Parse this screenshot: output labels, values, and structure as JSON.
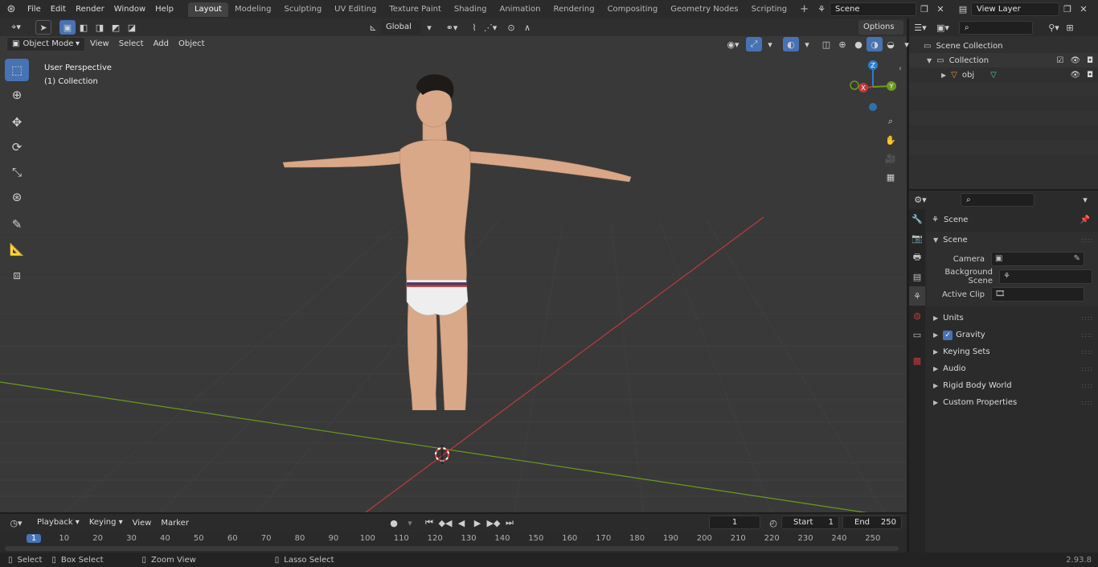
{
  "menu": [
    "File",
    "Edit",
    "Render",
    "Window",
    "Help"
  ],
  "workspaces": [
    "Layout",
    "Modeling",
    "Sculpting",
    "UV Editing",
    "Texture Paint",
    "Shading",
    "Animation",
    "Rendering",
    "Compositing",
    "Geometry Nodes",
    "Scripting"
  ],
  "active_workspace": "Layout",
  "scene_name": "Scene",
  "view_layer": "View Layer",
  "viewport": {
    "mode": "Object Mode",
    "menus": [
      "View",
      "Select",
      "Add",
      "Object"
    ],
    "transform_orientation": "Global",
    "options_label": "Options",
    "overlay_line1": "User Perspective",
    "overlay_line2": "(1) Collection",
    "gizmo_axes": [
      "X",
      "Y",
      "Z"
    ]
  },
  "outliner": {
    "root": "Scene Collection",
    "collection": "Collection",
    "object": "obj"
  },
  "properties": {
    "header": "Scene",
    "panel": "Scene",
    "fields": [
      {
        "label": "Camera",
        "value": ""
      },
      {
        "label": "Background Scene",
        "value": ""
      },
      {
        "label": "Active Clip",
        "value": ""
      }
    ],
    "sections": [
      "Units",
      "Gravity",
      "Keying Sets",
      "Audio",
      "Rigid Body World",
      "Custom Properties"
    ],
    "gravity_enabled": true
  },
  "timeline": {
    "menus": [
      "Playback",
      "Keying",
      "View",
      "Marker"
    ],
    "current_frame": "1",
    "start_label": "Start",
    "start": "1",
    "end_label": "End",
    "end": "250",
    "ticks": [
      "1",
      "10",
      "20",
      "30",
      "40",
      "50",
      "60",
      "70",
      "80",
      "90",
      "100",
      "110",
      "120",
      "130",
      "140",
      "150",
      "160",
      "170",
      "180",
      "190",
      "200",
      "210",
      "220",
      "230",
      "240",
      "250"
    ]
  },
  "statusbar": {
    "select": "Select",
    "box_select": "Box Select",
    "zoom_view": "Zoom View",
    "lasso_select": "Lasso Select",
    "version": "2.93.8"
  },
  "colors": {
    "accent": "#4772b3",
    "x_axis": "#c0393e",
    "y_axis": "#6b9a1f",
    "z_axis": "#2f7ec9"
  }
}
